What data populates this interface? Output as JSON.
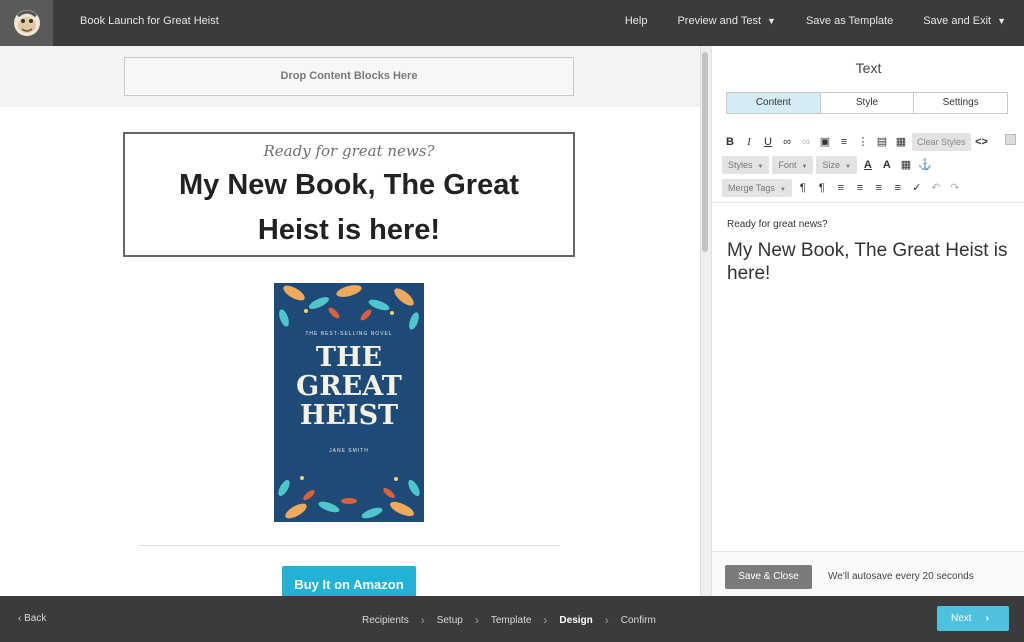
{
  "topbar": {
    "app_title": "Book Launch for Great Heist",
    "nav": {
      "help": "Help",
      "preview": "Preview and Test",
      "save_template": "Save as Template",
      "save_exit": "Save and Exit"
    }
  },
  "canvas": {
    "drop_zone": "Drop Content Blocks Here",
    "text_block": {
      "subtitle": "Ready for great news?",
      "headline_line1": "My New Book, The Great",
      "headline_line2": "Heist is here!"
    },
    "cover": {
      "tag": "THE BEST-SELLING NOVEL",
      "title_line1": "THE",
      "title_line2": "GREAT",
      "title_line3": "HEIST",
      "author": "JANE SMITH"
    },
    "buy_button": "Buy It on Amazon"
  },
  "panel": {
    "title": "Text",
    "tabs": [
      {
        "label": "Content",
        "active": true
      },
      {
        "label": "Style",
        "active": false
      },
      {
        "label": "Settings",
        "active": false
      }
    ],
    "toolbar": {
      "clear_styles": "Clear Styles",
      "styles": "Styles",
      "font": "Font",
      "size": "Size",
      "merge_tags": "Merge Tags"
    },
    "editor": {
      "subtitle": "Ready for great news?",
      "headline": "My New Book, The Great Heist is here!"
    },
    "footer": {
      "save_close": "Save & Close",
      "autosave": "We'll autosave every 20 seconds"
    }
  },
  "bottombar": {
    "back": "Back",
    "steps": [
      "Recipients",
      "Setup",
      "Template",
      "Design",
      "Confirm"
    ],
    "current_step": "Design",
    "next": "Next"
  },
  "colors": {
    "accent": "#22b2d6",
    "bar_bg": "#3b3b3b",
    "tab_active": "#d4ecf4",
    "cover_bg": "#1e4a78"
  }
}
